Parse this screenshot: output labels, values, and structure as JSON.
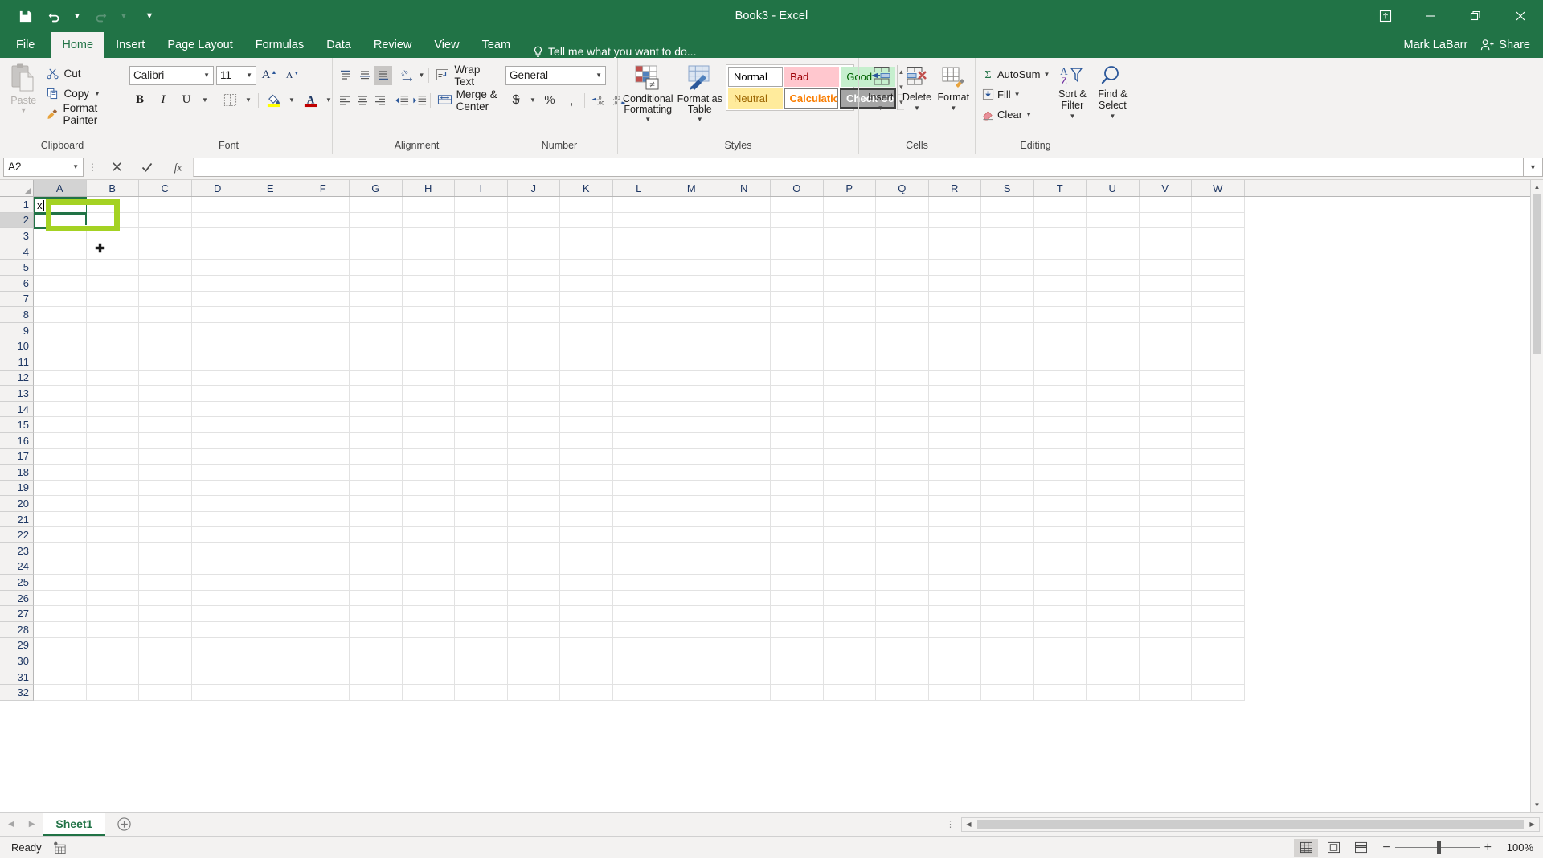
{
  "app": {
    "title": "Book3 - Excel",
    "username": "Mark LaBarr",
    "share_label": "Share",
    "accent_color": "#217346",
    "annotation_color": "#a4d223"
  },
  "quick_access": {
    "save": "save-icon",
    "undo": "undo-icon",
    "redo": "redo-icon",
    "customize": "customize-icon"
  },
  "window_controls": {
    "ribbon_display": "ribbon-display-options-icon",
    "minimize": "—",
    "restore": "restore-icon",
    "close": "✕"
  },
  "tabs": [
    {
      "label": "File",
      "active": false
    },
    {
      "label": "Home",
      "active": true
    },
    {
      "label": "Insert",
      "active": false
    },
    {
      "label": "Page Layout",
      "active": false
    },
    {
      "label": "Formulas",
      "active": false
    },
    {
      "label": "Data",
      "active": false
    },
    {
      "label": "Review",
      "active": false
    },
    {
      "label": "View",
      "active": false
    },
    {
      "label": "Team",
      "active": false
    }
  ],
  "tell_me": {
    "placeholder": "Tell me what you want to do..."
  },
  "ribbon": {
    "clipboard": {
      "group_label": "Clipboard",
      "paste": "Paste",
      "cut": "Cut",
      "copy": "Copy",
      "format_painter": "Format Painter"
    },
    "font": {
      "group_label": "Font",
      "font_name": "Calibri",
      "font_size": "11",
      "grow_font": "A",
      "shrink_font": "A",
      "bold": "B",
      "italic": "I",
      "underline": "U",
      "borders": "borders-icon",
      "fill_color": "fill-color-icon",
      "font_color": "font-color-icon"
    },
    "alignment": {
      "group_label": "Alignment",
      "align_top": "align-top-icon",
      "align_middle": "align-middle-icon",
      "align_bottom": "align-bottom-icon",
      "orientation": "orientation-icon",
      "align_left": "align-left-icon",
      "align_center": "align-center-icon",
      "align_right": "align-right-icon",
      "decrease_indent": "decrease-indent-icon",
      "increase_indent": "increase-indent-icon",
      "wrap_text": "Wrap Text",
      "merge_center": "Merge & Center"
    },
    "number": {
      "group_label": "Number",
      "format": "General",
      "accounting": "$",
      "percent": "%",
      "comma": ",",
      "increase_decimal": "increase-decimal-icon",
      "decrease_decimal": "decrease-decimal-icon"
    },
    "styles": {
      "group_label": "Styles",
      "conditional_formatting": "Conditional Formatting",
      "format_as_table": "Format as Table",
      "cell_styles": [
        {
          "label": "Normal",
          "bg": "#ffffff",
          "fg": "#000000",
          "border": "#a6a6a6",
          "bold": false
        },
        {
          "label": "Bad",
          "bg": "#ffc7ce",
          "fg": "#9c0006",
          "border": "transparent",
          "bold": false
        },
        {
          "label": "Good",
          "bg": "#c6efce",
          "fg": "#006100",
          "border": "transparent",
          "bold": false
        },
        {
          "label": "Neutral",
          "bg": "#ffeb9c",
          "fg": "#9c6500",
          "border": "transparent",
          "bold": false
        },
        {
          "label": "Calculation",
          "bg": "#ffffff",
          "fg": "#fa7d00",
          "border": "#7f7f7f",
          "bold": true
        },
        {
          "label": "Check Cell",
          "bg": "#a5a5a5",
          "fg": "#ffffff",
          "border": "#3f3f3f",
          "bold": true
        }
      ]
    },
    "cells": {
      "group_label": "Cells",
      "insert": "Insert",
      "delete": "Delete",
      "format": "Format"
    },
    "editing": {
      "group_label": "Editing",
      "autosum": "AutoSum",
      "fill": "Fill",
      "clear": "Clear",
      "sort_filter": "Sort & Filter",
      "find_select": "Find & Select"
    }
  },
  "formula_bar": {
    "name_box": "A2",
    "cancel": "cancel-icon",
    "enter": "enter-icon",
    "insert_function": "insert-function-icon",
    "value": "",
    "expand": "expand-formula-bar-icon"
  },
  "grid": {
    "columns": [
      "A",
      "B",
      "C",
      "D",
      "E",
      "F",
      "G",
      "H",
      "I",
      "J",
      "K",
      "L",
      "M",
      "N",
      "O",
      "P",
      "Q",
      "R",
      "S",
      "T",
      "U",
      "V",
      "W"
    ],
    "rows": [
      1,
      2,
      3,
      4,
      5,
      6,
      7,
      8,
      9,
      10,
      11,
      12,
      13,
      14,
      15,
      16,
      17,
      18,
      19,
      20,
      21,
      22,
      23,
      24,
      25,
      26,
      27,
      28,
      29,
      30,
      31,
      32
    ],
    "active_column": "A",
    "active_row": 2,
    "editing_cell": "A1",
    "editing_value": "x",
    "selected_cell": "A2"
  },
  "sheet_tabs": {
    "prev": "previous-sheet-icon",
    "next": "next-sheet-icon",
    "sheets": [
      "Sheet1"
    ],
    "active_sheet": "Sheet1",
    "add_sheet": "+"
  },
  "status_bar": {
    "state": "Ready",
    "macro_record": "record-macro-icon",
    "views": [
      "normal-view-icon",
      "page-layout-view-icon",
      "page-break-preview-icon"
    ],
    "active_view": "normal-view-icon",
    "zoom_out": "−",
    "zoom_in": "+",
    "zoom_level": "100%"
  }
}
